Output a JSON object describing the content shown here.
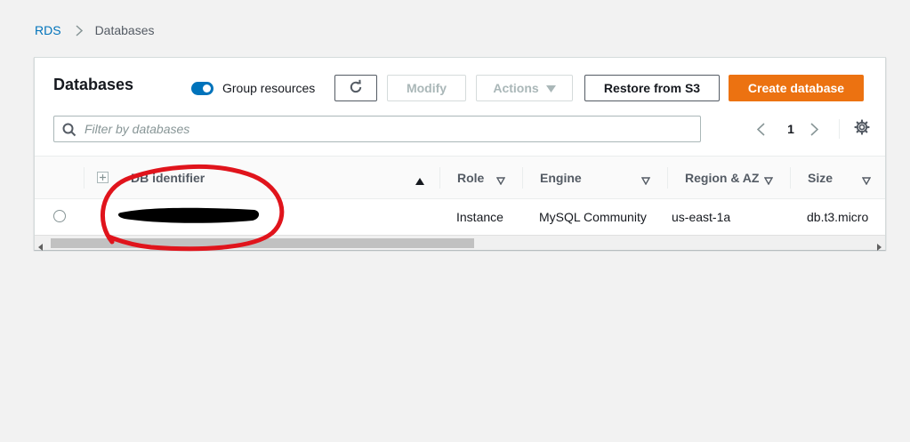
{
  "breadcrumb": {
    "root": "RDS",
    "current": "Databases"
  },
  "panel": {
    "title": "Databases",
    "group_resources_label": "Group resources",
    "group_resources_on": true,
    "buttons": {
      "modify": "Modify",
      "actions": "Actions",
      "restore": "Restore from S3",
      "create": "Create database"
    },
    "search_placeholder": "Filter by databases",
    "page": "1"
  },
  "table": {
    "columns": [
      "DB identifier",
      "Role",
      "Engine",
      "Region & AZ",
      "Size"
    ],
    "rows": [
      {
        "db_identifier": "",
        "role": "Instance",
        "engine": "MySQL Community",
        "region_az": "us-east-1a",
        "size": "db.t3.micro"
      }
    ]
  },
  "icons": {
    "breadcrumb_separator": "chevron-right-icon",
    "refresh": "refresh-icon",
    "actions_caret": "caret-down-icon",
    "search": "search-icon",
    "prev": "chevron-left-icon",
    "next": "chevron-right-icon",
    "settings": "gear-icon",
    "expand_all": "expand-icon",
    "sort_asc": "sort-ascending-icon",
    "sort": "sort-icon"
  },
  "colors": {
    "primary_button": "#ec7211",
    "toggle": "#0073bb",
    "link": "#0073bb",
    "annotation": "#e0141c",
    "redaction": "#000000"
  }
}
